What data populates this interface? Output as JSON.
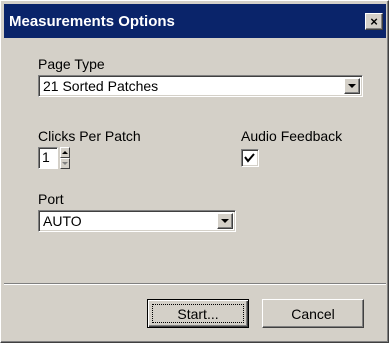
{
  "window": {
    "title": "Measurements Options",
    "close_glyph": "×"
  },
  "page_type": {
    "label": "Page Type",
    "value": "21 Sorted Patches"
  },
  "clicks_per_patch": {
    "label": "Clicks Per Patch",
    "value": "1"
  },
  "audio_feedback": {
    "label": "Audio Feedback",
    "checked": true
  },
  "port": {
    "label": "Port",
    "value": "AUTO"
  },
  "buttons": {
    "start": "Start...",
    "cancel": "Cancel"
  },
  "colors": {
    "titlebar": "#0a246a",
    "face": "#d4d0c8"
  }
}
